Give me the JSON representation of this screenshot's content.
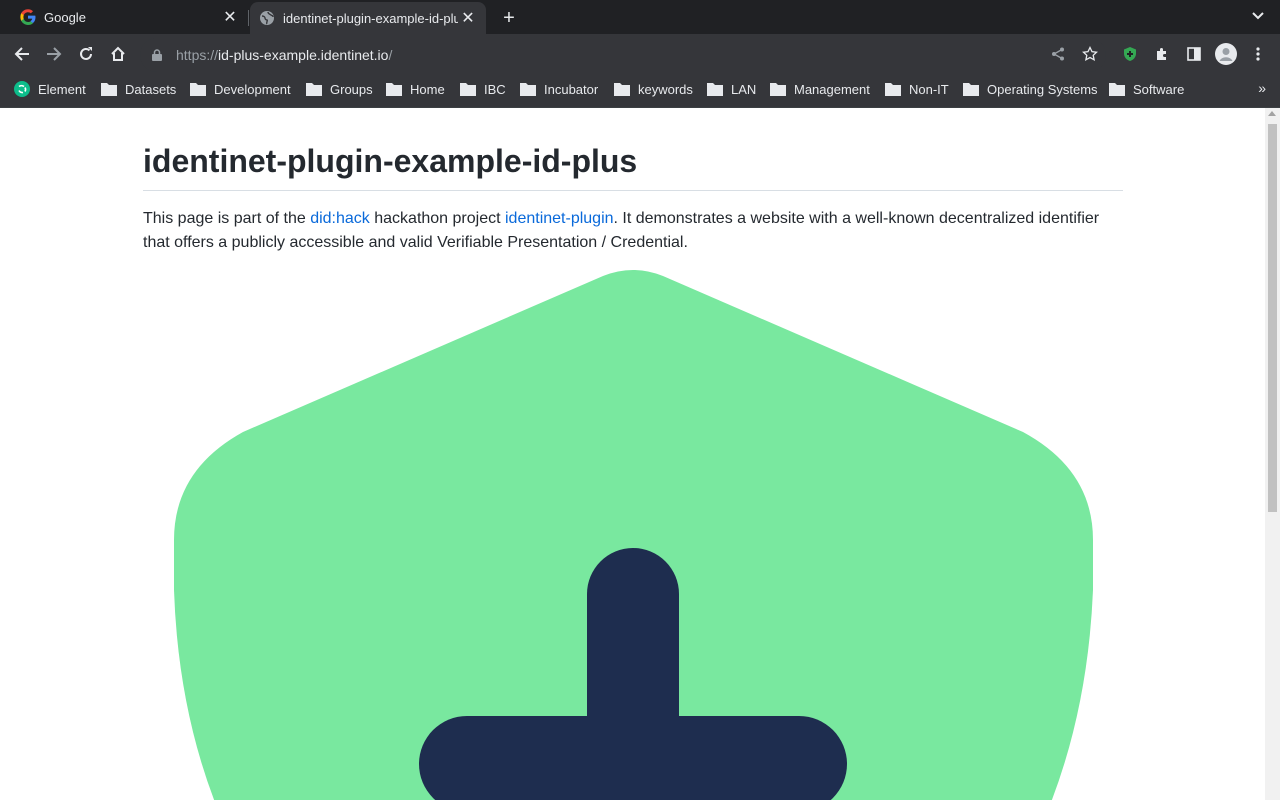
{
  "browser": {
    "tabs": [
      {
        "title": "Google",
        "active": false
      },
      {
        "title": "identinet-plugin-example-id-plus",
        "active": true
      }
    ],
    "url": {
      "scheme": "https://",
      "host": "id-plus-example.identinet.io",
      "path": "/"
    },
    "bookmarks": [
      {
        "label": "Element",
        "icon": "element-icon"
      },
      {
        "label": "Datasets",
        "icon": "folder-icon"
      },
      {
        "label": "Development",
        "icon": "folder-icon"
      },
      {
        "label": "Groups",
        "icon": "folder-icon"
      },
      {
        "label": "Home",
        "icon": "folder-icon"
      },
      {
        "label": "IBC",
        "icon": "folder-icon"
      },
      {
        "label": "Incubator",
        "icon": "folder-icon"
      },
      {
        "label": "keywords",
        "icon": "folder-icon"
      },
      {
        "label": "LAN",
        "icon": "folder-icon"
      },
      {
        "label": "Management",
        "icon": "folder-icon"
      },
      {
        "label": "Non-IT",
        "icon": "folder-icon"
      },
      {
        "label": "Operating Systems",
        "icon": "folder-icon"
      },
      {
        "label": "Software",
        "icon": "folder-icon"
      }
    ],
    "more_bookmarks": "»"
  },
  "page": {
    "heading": "identinet-plugin-example-id-plus",
    "intro": {
      "part1": "This page is part of the ",
      "link1": "did:hack",
      "part2": " hackathon project ",
      "link2": "identinet-plugin",
      "part3": ". It demonstrates a website with a well-known decentralized identifier that offers a publicly accessible and valid Verifiable Presentation / Credential."
    },
    "logo": {
      "shield_color": "#79e89f",
      "mark_color": "#1e2d4f"
    }
  }
}
